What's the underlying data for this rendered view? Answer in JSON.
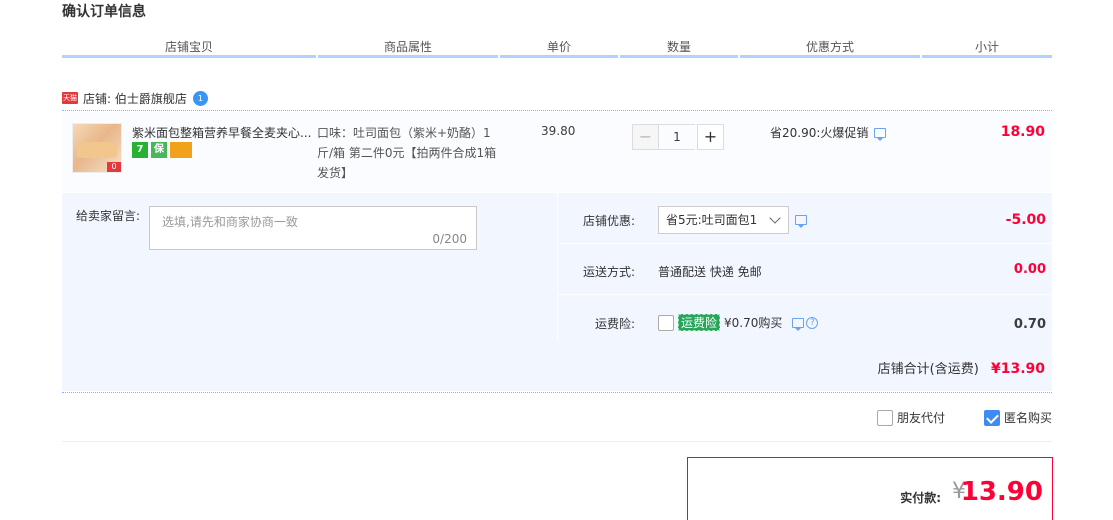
{
  "page": {
    "title": "确认订单信息"
  },
  "columns": [
    "店铺宝贝",
    "商品属性",
    "单价",
    "数量",
    "优惠方式",
    "小计"
  ],
  "shop": {
    "badge": "天猫",
    "name": "店铺: 伯士爵旗舰店",
    "ww_count": "1"
  },
  "item": {
    "title": "紫米面包整箱营养早餐全麦夹心...",
    "services": [
      "7",
      "保",
      "card"
    ],
    "image_tag": "0",
    "property": "口味：吐司面包（紫米+奶酪）1斤/箱 第二件0元【拍两件合成1箱发货】",
    "price": "39.80",
    "quantity": "1",
    "minus": "−",
    "plus": "+",
    "promo": "省20.90:火爆促销",
    "subtotal": "18.90"
  },
  "message": {
    "label": "给卖家留言:",
    "placeholder": "选填,请先和商家协商一致",
    "counter": "0/200"
  },
  "options": {
    "coupon": {
      "label": "店铺优惠:",
      "selected": "省5元:吐司面包1",
      "amount": "-5.00"
    },
    "shipping": {
      "label": "运送方式:",
      "value": "普通配送 快递 免邮",
      "amount": "0.00"
    },
    "insurance": {
      "label": "运费险:",
      "tag": "运费险",
      "text": "¥0.70购买",
      "help": "?",
      "amount": "0.70"
    }
  },
  "shop_total": {
    "label": "店铺合计(含运费)",
    "amount": "¥13.90"
  },
  "extras": {
    "friend_pay": "朋友代付",
    "anonymous": "匿名购买"
  },
  "payment": {
    "label": "实付款:",
    "yen": "¥",
    "amount": "13.90"
  },
  "colors": {
    "accent": "#ff0036",
    "header_line": "#b2d1ff",
    "panel_bg": "#f2f7ff",
    "checkbox": "#3f8bf1"
  }
}
